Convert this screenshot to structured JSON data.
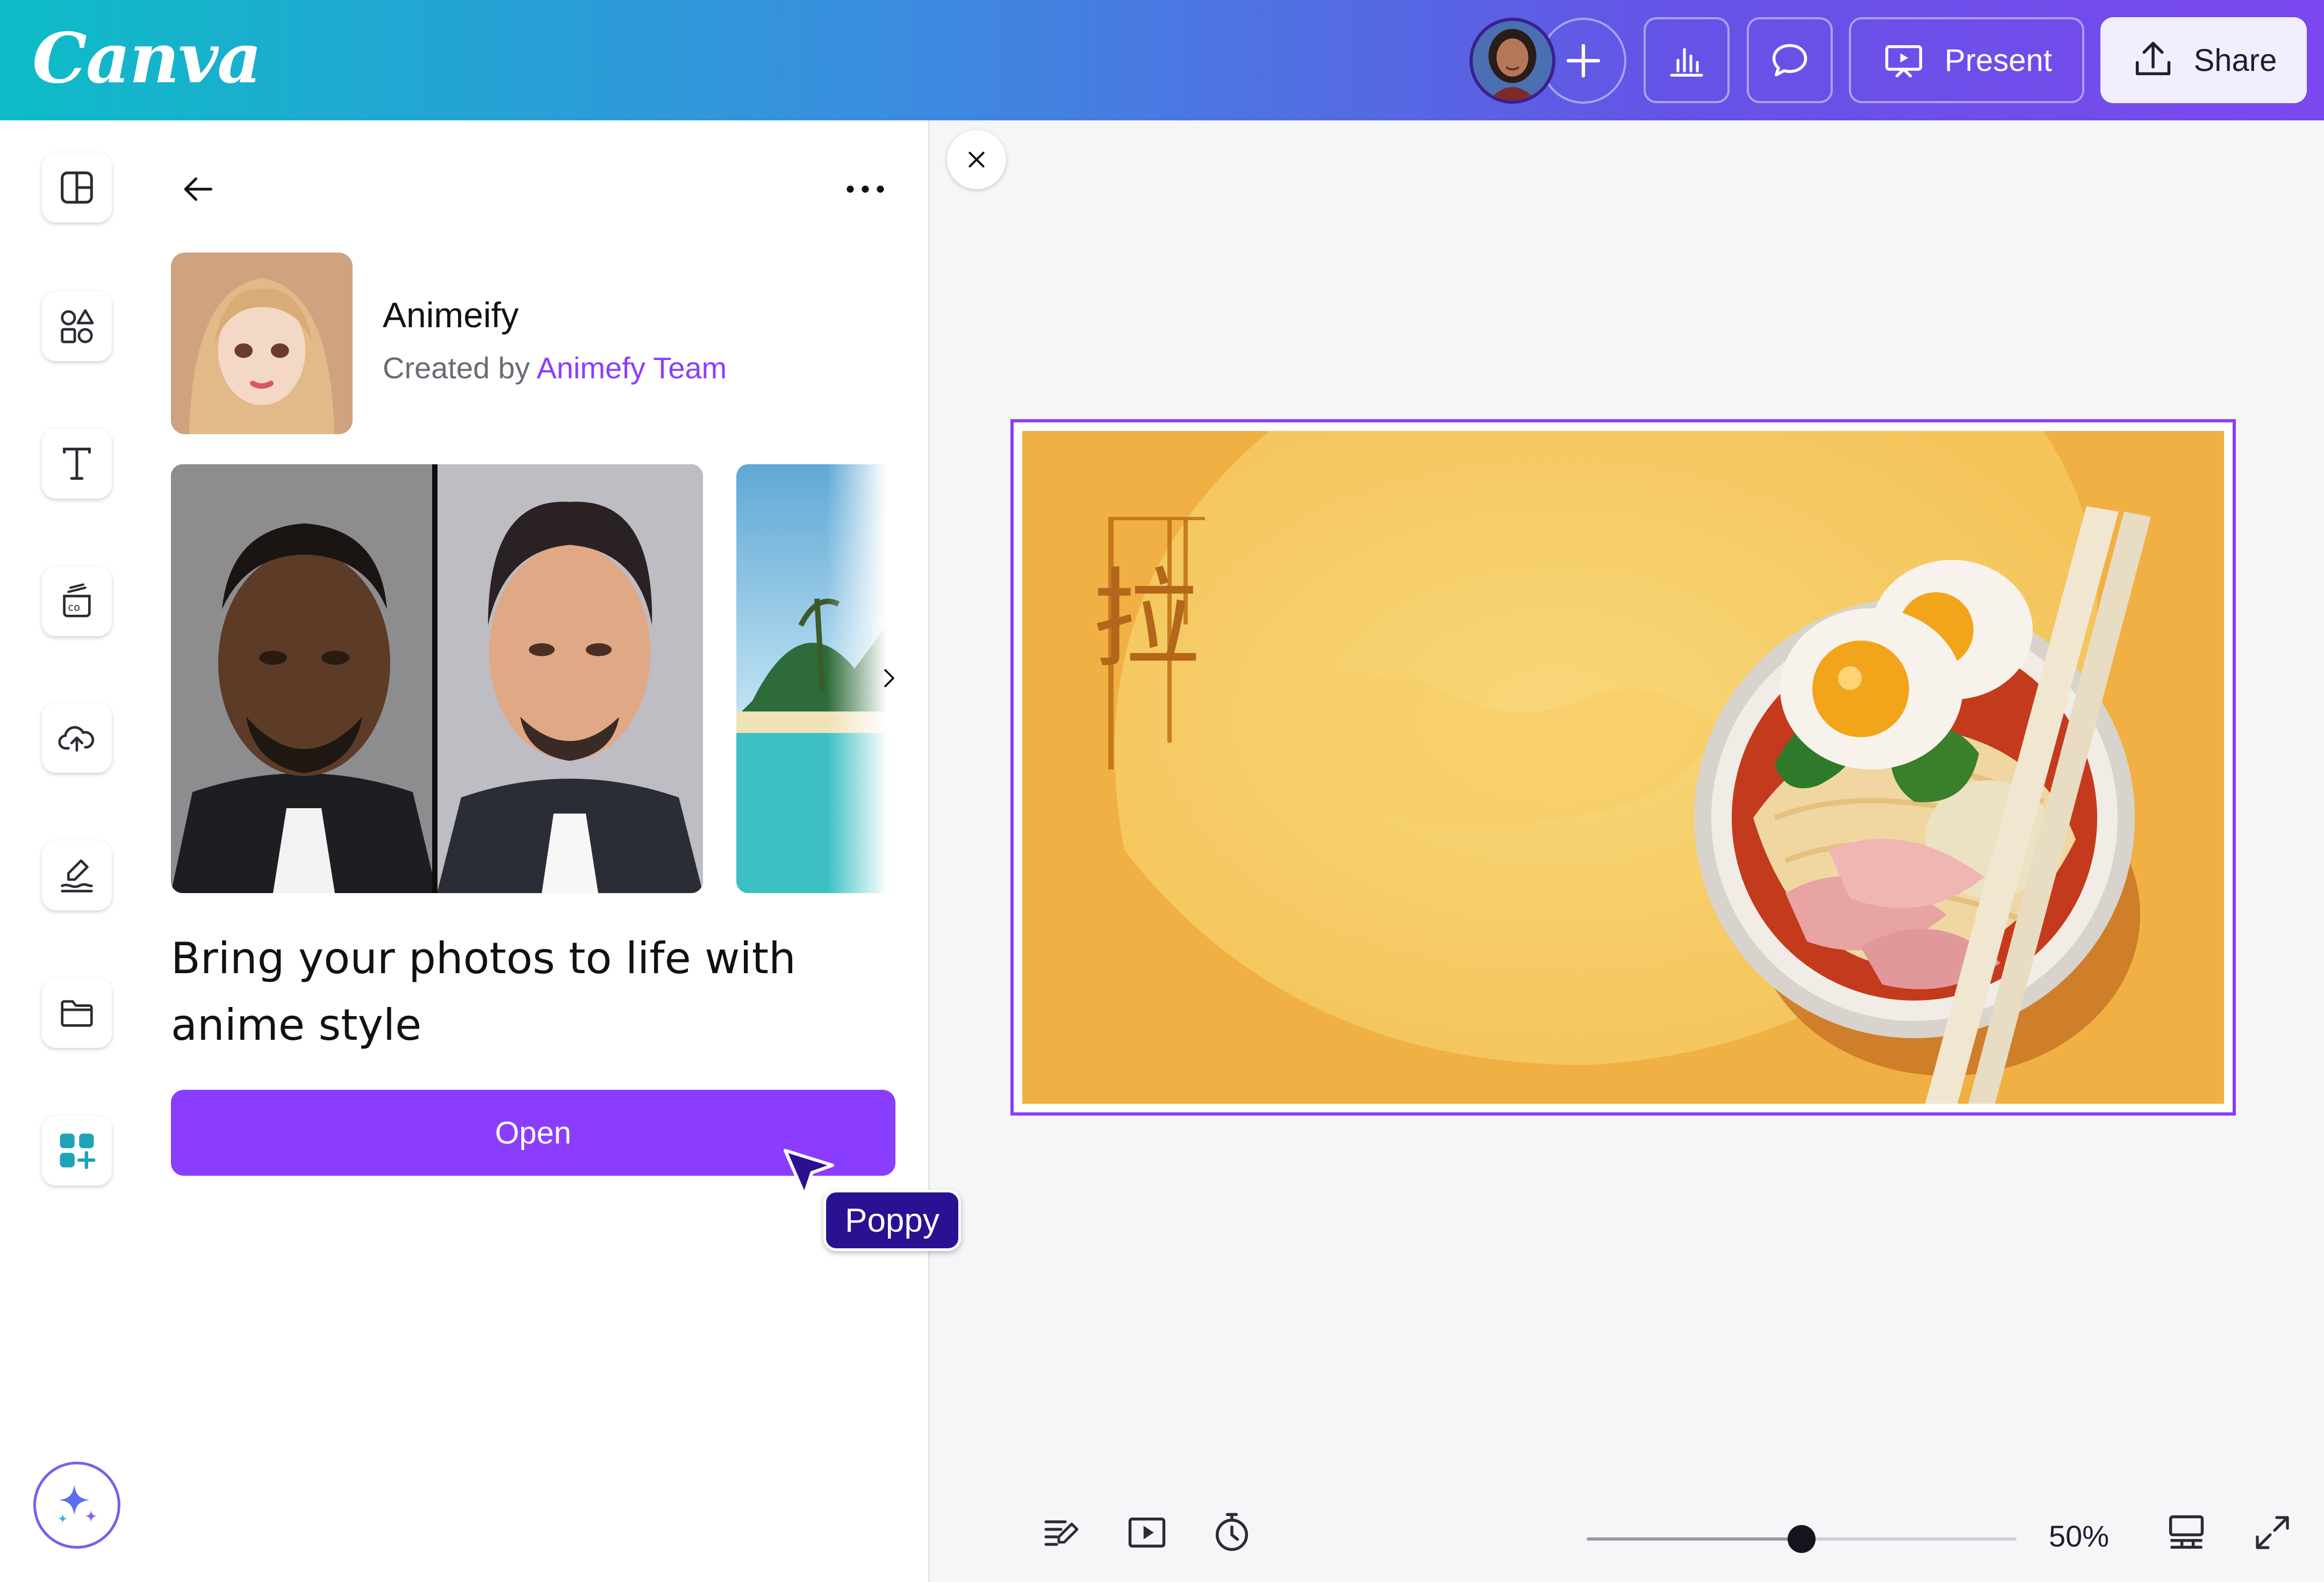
{
  "app": {
    "brand": "Canva"
  },
  "header": {
    "present_label": "Present",
    "share_label": "Share"
  },
  "panel": {
    "app_name": "Animeify",
    "created_by_prefix": "Created by",
    "author": "Animefy Team",
    "tagline": "Bring your photos to life with anime style",
    "open_label": "Open"
  },
  "collaborator_cursor": {
    "name": "Poppy"
  },
  "design_text": {
    "calligraphy": "拉"
  },
  "footer": {
    "zoom_label": "50%",
    "zoom_value": 0.5
  },
  "colors": {
    "accent": "#8b3dff",
    "cursor": "#2a1192",
    "design_background": "#f1b044"
  }
}
